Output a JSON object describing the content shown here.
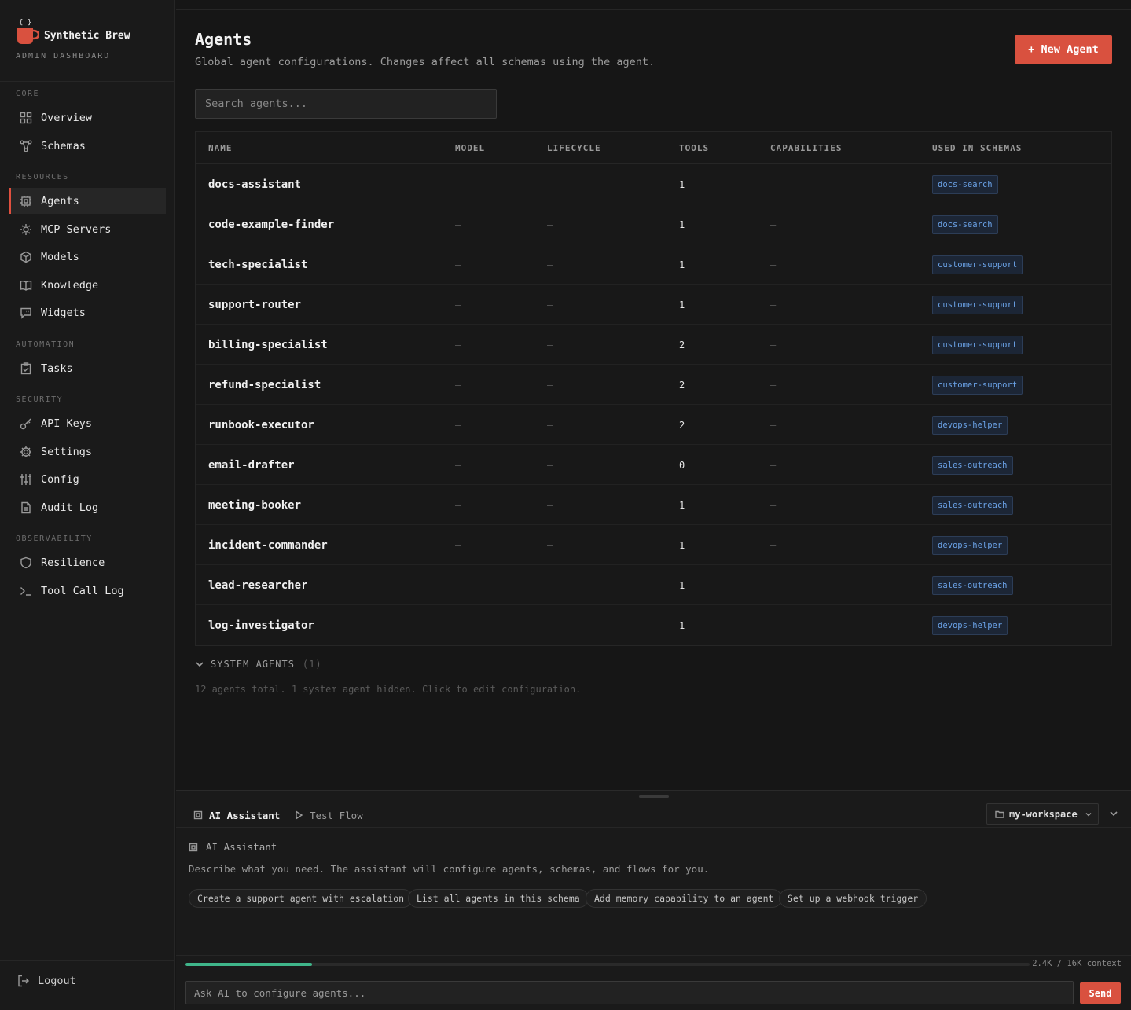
{
  "brand": {
    "name": "Synthetic Brew",
    "subtitle": "ADMIN DASHBOARD",
    "logo_glyph": "{ }",
    "accent": "#d9513f"
  },
  "sidebar": {
    "sections": [
      {
        "label": "CORE",
        "items": [
          {
            "label": "Overview",
            "icon": "grid-icon"
          },
          {
            "label": "Schemas",
            "icon": "flow-icon"
          }
        ]
      },
      {
        "label": "RESOURCES",
        "items": [
          {
            "label": "Agents",
            "icon": "cpu-icon",
            "active": true
          },
          {
            "label": "MCP Servers",
            "icon": "sun-icon"
          },
          {
            "label": "Models",
            "icon": "cube-icon"
          },
          {
            "label": "Knowledge",
            "icon": "book-icon"
          },
          {
            "label": "Widgets",
            "icon": "chat-icon"
          }
        ]
      },
      {
        "label": "AUTOMATION",
        "items": [
          {
            "label": "Tasks",
            "icon": "clipboard-icon"
          }
        ]
      },
      {
        "label": "SECURITY",
        "items": [
          {
            "label": "API Keys",
            "icon": "key-icon"
          },
          {
            "label": "Settings",
            "icon": "gear-icon"
          },
          {
            "label": "Config",
            "icon": "sliders-icon"
          },
          {
            "label": "Audit Log",
            "icon": "document-icon"
          }
        ]
      },
      {
        "label": "OBSERVABILITY",
        "items": [
          {
            "label": "Resilience",
            "icon": "shield-icon"
          },
          {
            "label": "Tool Call Log",
            "icon": "terminal-icon"
          }
        ]
      }
    ],
    "logout_label": "Logout"
  },
  "page": {
    "title": "Agents",
    "subtitle": "Global agent configurations. Changes affect all schemas using the agent.",
    "new_button_label": "+ New Agent",
    "search_placeholder": "Search agents..."
  },
  "table": {
    "columns": [
      "NAME",
      "MODEL",
      "LIFECYCLE",
      "TOOLS",
      "CAPABILITIES",
      "USED IN SCHEMAS"
    ],
    "empty_value": "—",
    "rows": [
      {
        "name": "docs-assistant",
        "tools": "1",
        "schema": "docs-search"
      },
      {
        "name": "code-example-finder",
        "tools": "1",
        "schema": "docs-search"
      },
      {
        "name": "tech-specialist",
        "tools": "1",
        "schema": "customer-support"
      },
      {
        "name": "support-router",
        "tools": "1",
        "schema": "customer-support"
      },
      {
        "name": "billing-specialist",
        "tools": "2",
        "schema": "customer-support"
      },
      {
        "name": "refund-specialist",
        "tools": "2",
        "schema": "customer-support"
      },
      {
        "name": "runbook-executor",
        "tools": "2",
        "schema": "devops-helper"
      },
      {
        "name": "email-drafter",
        "tools": "0",
        "schema": "sales-outreach"
      },
      {
        "name": "meeting-booker",
        "tools": "1",
        "schema": "sales-outreach"
      },
      {
        "name": "incident-commander",
        "tools": "1",
        "schema": "devops-helper"
      },
      {
        "name": "lead-researcher",
        "tools": "1",
        "schema": "sales-outreach"
      },
      {
        "name": "log-investigator",
        "tools": "1",
        "schema": "devops-helper"
      }
    ]
  },
  "system_agents": {
    "label": "SYSTEM AGENTS",
    "count": "(1)"
  },
  "footer_note": "12 agents total. 1 system agent hidden. Click to edit configuration.",
  "panel": {
    "tabs": [
      {
        "label": "AI Assistant",
        "icon": "cpu-icon",
        "active": true
      },
      {
        "label": "Test Flow",
        "icon": "play-icon"
      }
    ],
    "workspace": "my-workspace",
    "assistant_title": "AI Assistant",
    "assistant_desc": "Describe what you need. The assistant will configure agents, schemas, and flows for you.",
    "suggestions": [
      "Create a support agent with escalation",
      "List all agents in this schema",
      "Add memory capability to an agent",
      "Set up a webhook trigger"
    ],
    "context_label": "2.4K / 16K context",
    "context_fraction": 0.15,
    "context_color": "#3fb58a",
    "input_placeholder": "Ask AI to configure agents...",
    "send_label": "Send"
  }
}
